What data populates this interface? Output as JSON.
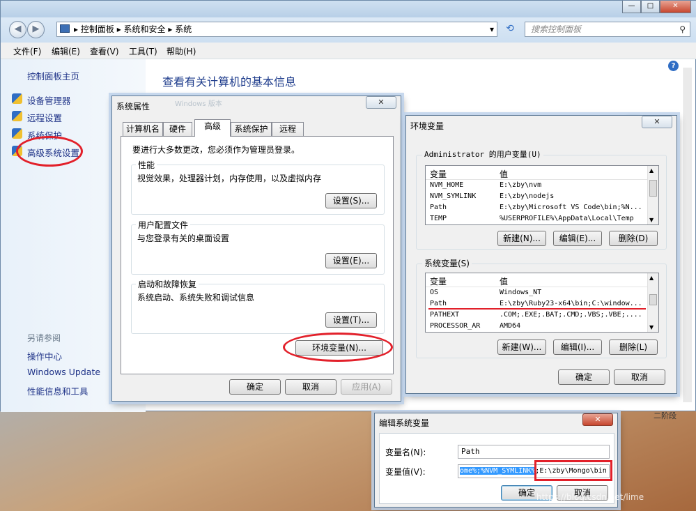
{
  "titlebar": {
    "min": "—",
    "max": "□",
    "close": "✕"
  },
  "address": {
    "path": [
      "控制面板",
      "系统和安全",
      "系统"
    ],
    "search_placeholder": "搜索控制面板"
  },
  "menu": [
    "文件(F)",
    "编辑(E)",
    "查看(V)",
    "工具(T)",
    "帮助(H)"
  ],
  "leftpane": {
    "home": "控制面板主页",
    "links": [
      "设备管理器",
      "远程设置",
      "系统保护",
      "高级系统设置"
    ],
    "see_also": "另请参阅",
    "also": [
      "操作中心",
      "Windows Update",
      "性能信息和工具"
    ]
  },
  "main": {
    "heading": "查看有关计算机的基本信息",
    "faded": "Windows 版本"
  },
  "sysprops": {
    "title": "系统属性",
    "tabs": [
      "计算机名",
      "硬件",
      "高级",
      "系统保护",
      "远程"
    ],
    "admin_note": "要进行大多数更改，您必须作为管理员登录。",
    "perf": {
      "label": "性能",
      "desc": "视觉效果，处理器计划，内存使用，以及虚拟内存",
      "btn": "设置(S)..."
    },
    "profile": {
      "label": "用户配置文件",
      "desc": "与您登录有关的桌面设置",
      "btn": "设置(E)..."
    },
    "startup": {
      "label": "启动和故障恢复",
      "desc": "系统启动、系统失败和调试信息",
      "btn": "设置(T)..."
    },
    "envbtn": "环境变量(N)...",
    "ok": "确定",
    "cancel": "取消",
    "apply": "应用(A)"
  },
  "envvars": {
    "title": "环境变量",
    "user_label": "Administrator 的用户变量(U)",
    "col_var": "变量",
    "col_val": "值",
    "user_rows": [
      {
        "name": "NVM_HOME",
        "value": "E:\\zby\\nvm"
      },
      {
        "name": "NVM_SYMLINK",
        "value": "E:\\zby\\nodejs"
      },
      {
        "name": "Path",
        "value": "E:\\zby\\Microsoft VS Code\\bin;%N..."
      },
      {
        "name": "TEMP",
        "value": "%USERPROFILE%\\AppData\\Local\\Temp"
      }
    ],
    "sys_label": "系统变量(S)",
    "sys_rows": [
      {
        "name": "OS",
        "value": "Windows_NT"
      },
      {
        "name": "Path",
        "value": "E:\\zby\\Ruby23-x64\\bin;C:\\window..."
      },
      {
        "name": "PATHEXT",
        "value": ".COM;.EXE;.BAT;.CMD;.VBS;.VBE;...."
      },
      {
        "name": "PROCESSOR_AR",
        "value": "AMD64"
      }
    ],
    "new_u": "新建(N)...",
    "edit_u": "编辑(E)...",
    "del_u": "删除(D)",
    "new_s": "新建(W)...",
    "edit_s": "编辑(I)...",
    "del_s": "删除(L)",
    "ok": "确定",
    "cancel": "取消"
  },
  "editvar": {
    "title": "编辑系统变量",
    "name_label": "变量名(N):",
    "name_value": "Path",
    "value_label": "变量值(V):",
    "value_sel": "ome%;%NVM_SYMLINK%",
    "value_tail": ";E:\\zby\\Mongo\\bin",
    "ok": "确定",
    "cancel": "取消"
  },
  "bg_text": "二阶段",
  "watermark": "https://blog.csdn.net/lime"
}
